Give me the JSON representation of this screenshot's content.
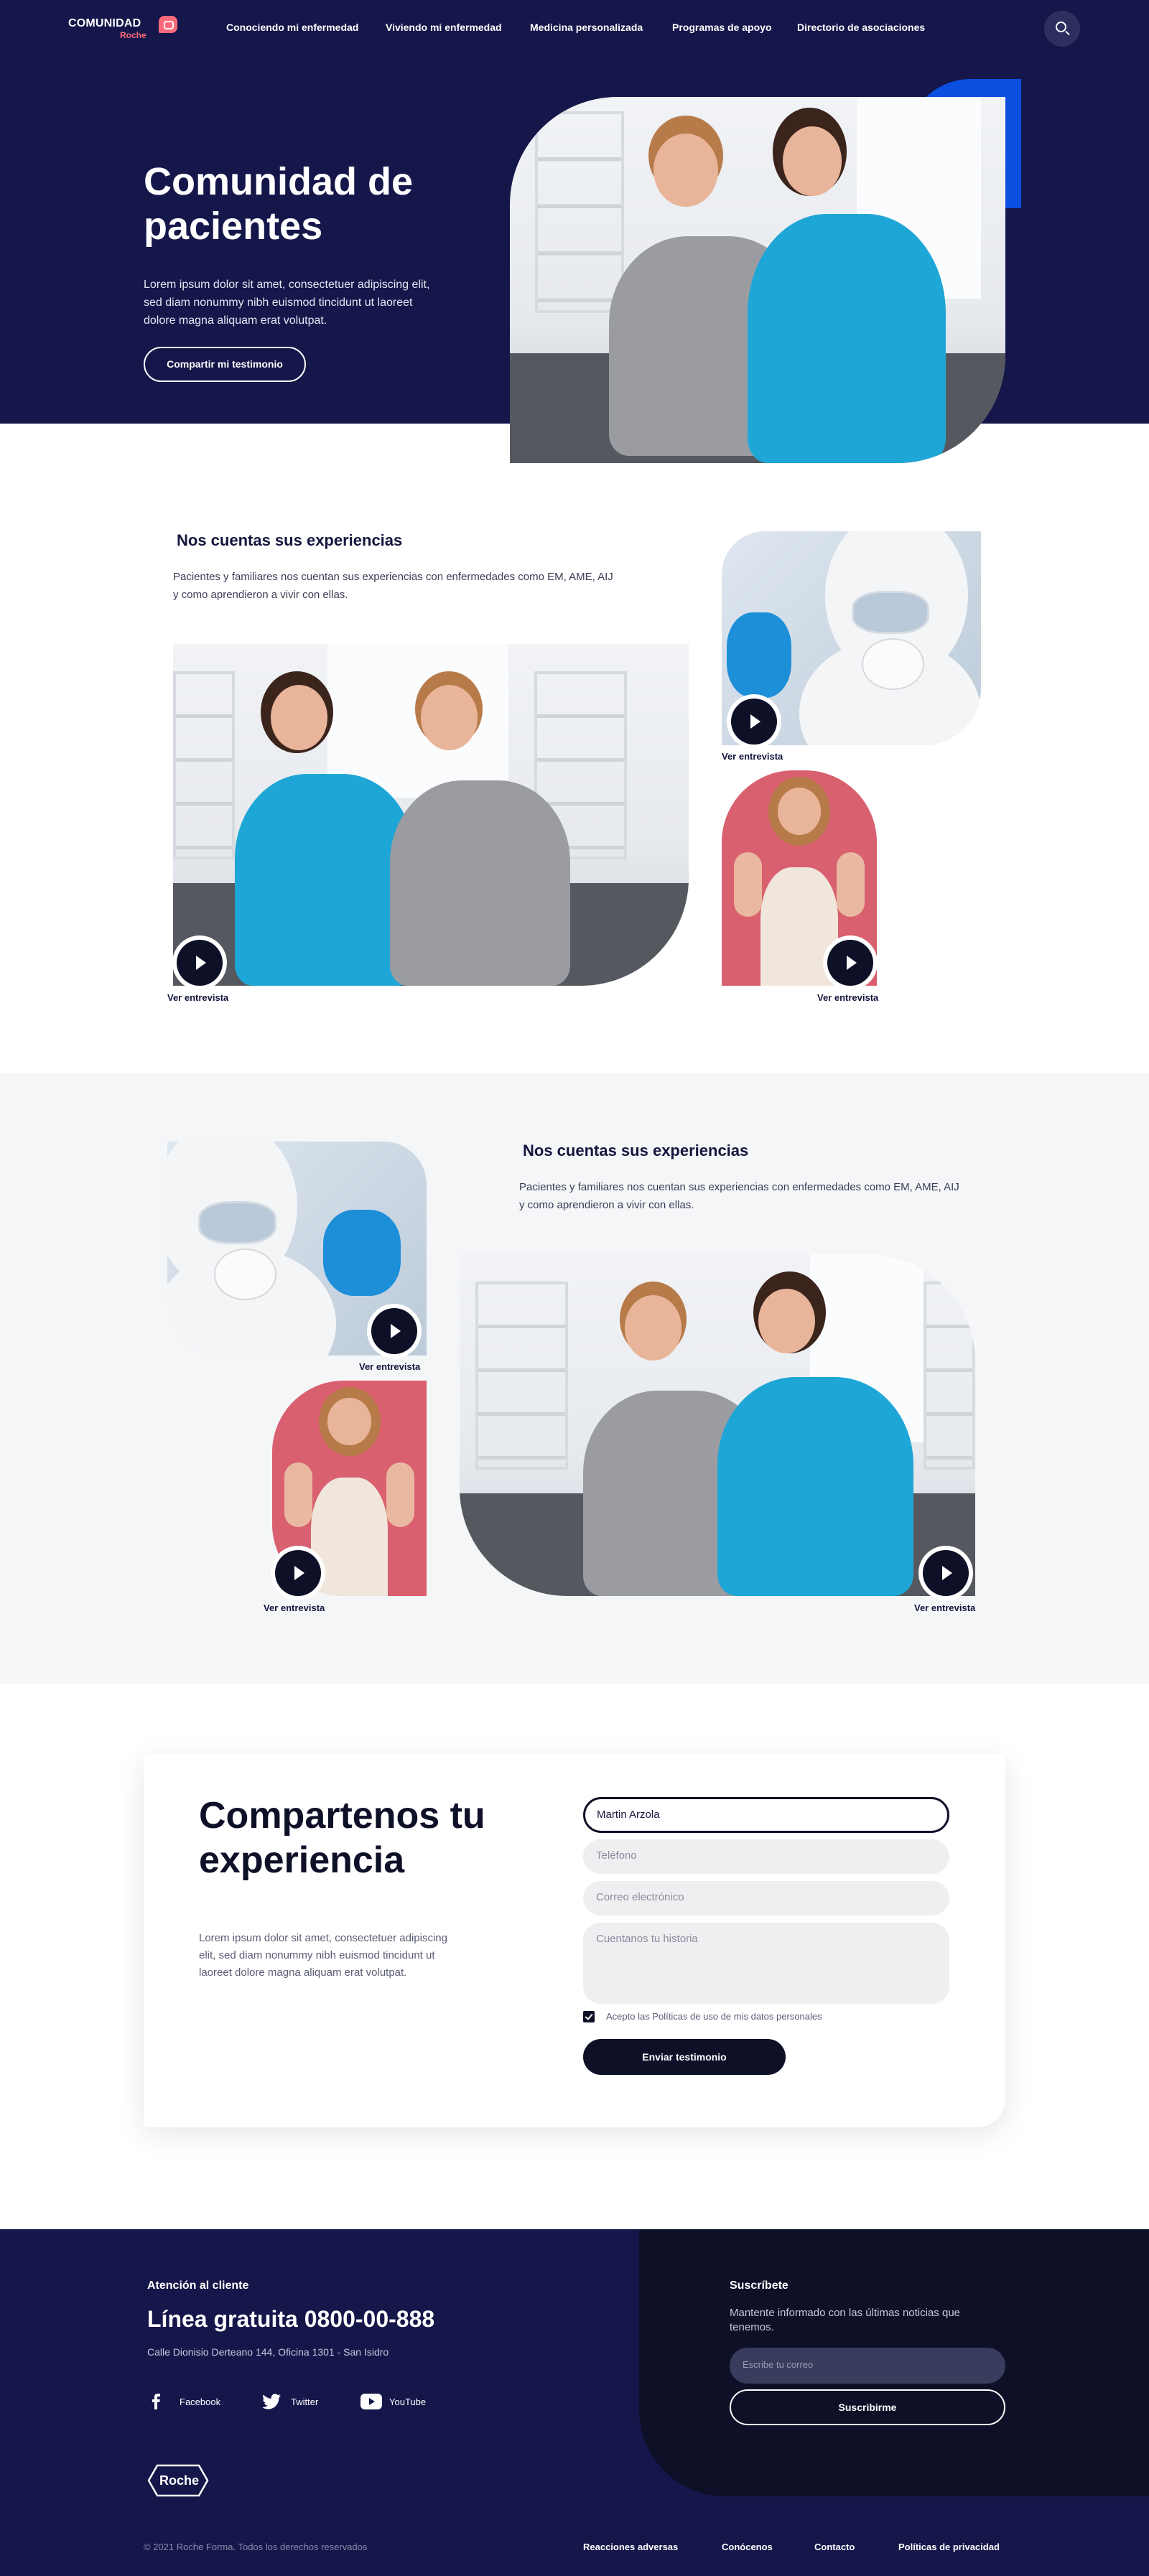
{
  "header": {
    "logo_text": "COMUNIDAD",
    "logo_sub": "Roche",
    "nav": [
      {
        "label": "Conociendo mi enfermedad"
      },
      {
        "label": "Viviendo mi enfermedad"
      },
      {
        "label": "Medicina personalizada"
      },
      {
        "label": "Programas de apoyo"
      },
      {
        "label": "Directorio de asociaciones"
      }
    ],
    "search_icon": "search-icon"
  },
  "hero": {
    "title": "Comunidad de pacientes",
    "description": "Lorem ipsum dolor sit amet, consectetuer adipiscing elit, sed diam nonummy nibh euismod tincidunt ut laoreet dolore magna aliquam erat volutpat.",
    "button": "Compartir mi testimonio"
  },
  "section1": {
    "title": "Nos cuentas sus experiencias",
    "description": "Pacientes y familiares nos cuentan sus experiencias con enfermedades como EM, AME, AIJ y como aprendieron a vivir con ellas.",
    "videos": [
      {
        "label": "Ver entrevista"
      },
      {
        "label": "Ver entrevista"
      },
      {
        "label": "Ver entrevista"
      }
    ]
  },
  "section2": {
    "title": "Nos cuentas sus experiencias",
    "description": "Pacientes y familiares nos cuentan sus experiencias con enfermedades como EM, AME, AIJ y como aprendieron a vivir con ellas.",
    "videos": [
      {
        "label": "Ver entrevista"
      },
      {
        "label": "Ver entrevista"
      },
      {
        "label": "Ver entrevista"
      }
    ]
  },
  "form": {
    "title": "Compartenos tu experiencia",
    "description": "Lorem ipsum dolor sit amet, consectetuer adipiscing elit, sed diam nonummy nibh euismod tincidunt ut laoreet dolore magna aliquam erat volutpat.",
    "name_value": "Martin Arzola",
    "phone_placeholder": "Teléfono",
    "email_placeholder": "Correo electrónico",
    "story_placeholder": "Cuentanos tu historia",
    "consent_label": "Acepto las Políticas de uso de mis datos personales",
    "consent_checked": true,
    "submit": "Enviar testimonio"
  },
  "footer": {
    "attention_title": "Atención al cliente",
    "phone_line": "Línea gratuita 0800-00-888",
    "address": "Calle Dionisio Derteano 144, Oficina 1301 - San Isidro",
    "social": [
      {
        "label": "Facebook",
        "icon": "facebook-icon"
      },
      {
        "label": "Twitter",
        "icon": "twitter-icon"
      },
      {
        "label": "YouTube",
        "icon": "youtube-icon"
      }
    ],
    "brand": "Roche",
    "subscribe_title": "Suscríbete",
    "subscribe_desc": "Mantente informado con las últimas noticias que tenemos.",
    "subscribe_placeholder": "Escribe tu correo",
    "subscribe_button": "Suscribirme",
    "copyright": "© 2021 Roche Forma. Todos los derechos reservados",
    "links": [
      {
        "label": "Reacciones adversas"
      },
      {
        "label": "Conócenos"
      },
      {
        "label": "Contacto"
      },
      {
        "label": "Políticas de privacidad"
      }
    ]
  },
  "colors": {
    "navy": "#15164a",
    "dark": "#0e1028",
    "accent_blue": "#0b4fe0",
    "coral": "#ff6a7a"
  }
}
